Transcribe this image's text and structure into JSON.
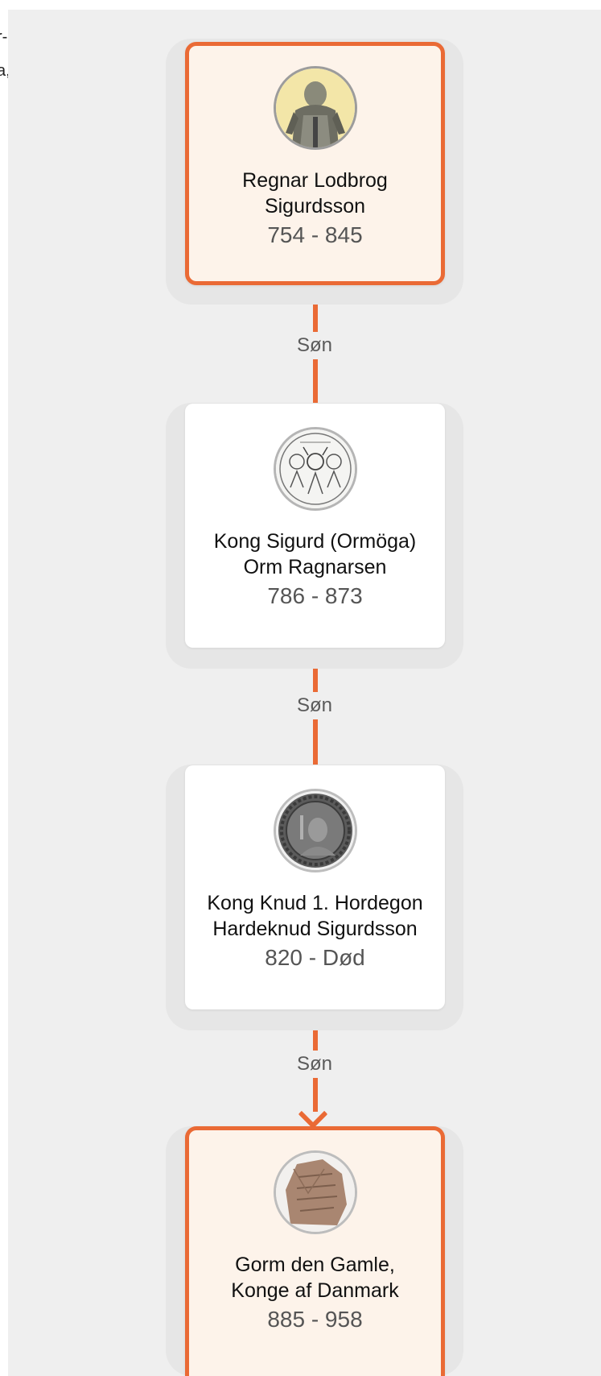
{
  "edge": {
    "top_fragment": "r-",
    "second_fragment": "a,"
  },
  "colors": {
    "accent": "#ea6a35",
    "highlight_bg": "#fdf3ea",
    "panel_bg": "#efefef"
  },
  "tree": {
    "people": [
      {
        "name_line1": "Regnar Lodbrog",
        "name_line2": "Sigurdsson",
        "years": "754 - 845",
        "highlighted": true,
        "avatar_icon": "portrait-icon"
      },
      {
        "name_line1": "Kong Sigurd (Ormöga)",
        "name_line2": "Orm Ragnarsen",
        "years": "786 - 873",
        "highlighted": false,
        "avatar_icon": "drawing-icon"
      },
      {
        "name_line1": "Kong Knud 1. Hordegon",
        "name_line2": "Hardeknud Sigurdsson",
        "years": "820 - Død",
        "highlighted": false,
        "avatar_icon": "coin-icon"
      },
      {
        "name_line1": "Gorm den Gamle,",
        "name_line2": "Konge af Danmark",
        "years": "885 - 958",
        "highlighted": true,
        "avatar_icon": "runestone-icon"
      }
    ],
    "relations": [
      {
        "label": "Søn"
      },
      {
        "label": "Søn"
      },
      {
        "label": "Søn"
      }
    ]
  }
}
